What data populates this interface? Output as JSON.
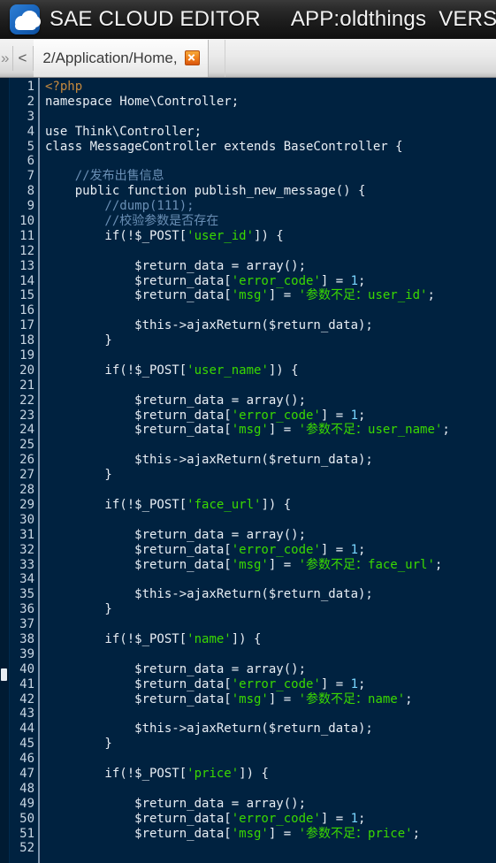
{
  "titlebar": {
    "app_title": "SAE CLOUD EDITOR",
    "app_name": "APP:oldthings",
    "version_label": "VERSIO",
    "logo_icon": "cloud-logo-icon"
  },
  "tabbar": {
    "overflow_chevron": "»",
    "back_arrow": "<",
    "tab_label": "2/Application/Home,",
    "close_icon": "close-icon"
  },
  "editor": {
    "language": "php",
    "first_line": 1,
    "last_line": 52,
    "colors": {
      "background": "#002240",
      "gutter_text": "#c8d6e3",
      "plain": "#e8eef4",
      "comment": "#6a8fb5",
      "string": "#3ad900",
      "number": "#79d6ff",
      "keyword": "#e6e6c8",
      "php_tag": "#c5893d"
    },
    "lines": [
      {
        "n": 1,
        "tokens": [
          {
            "t": "<?php",
            "c": "tag"
          }
        ]
      },
      {
        "n": 2,
        "tokens": [
          {
            "t": "namespace Home\\Controller;",
            "c": "plain"
          }
        ]
      },
      {
        "n": 3,
        "tokens": []
      },
      {
        "n": 4,
        "tokens": [
          {
            "t": "use Think\\Controller;",
            "c": "plain"
          }
        ]
      },
      {
        "n": 5,
        "tokens": [
          {
            "t": "class MessageController extends BaseController {",
            "c": "plain"
          }
        ]
      },
      {
        "n": 6,
        "tokens": []
      },
      {
        "n": 7,
        "tokens": [
          {
            "t": "    //发布出售信息",
            "c": "comment"
          }
        ]
      },
      {
        "n": 8,
        "tokens": [
          {
            "t": "    public function publish_new_message() {",
            "c": "plain"
          }
        ]
      },
      {
        "n": 9,
        "tokens": [
          {
            "t": "        //dump(111);",
            "c": "comment"
          }
        ]
      },
      {
        "n": 10,
        "tokens": [
          {
            "t": "        //校验参数是否存在",
            "c": "comment"
          }
        ]
      },
      {
        "n": 11,
        "tokens": [
          {
            "t": "        if(!$_POST[",
            "c": "plain"
          },
          {
            "t": "'user_id'",
            "c": "string"
          },
          {
            "t": "]) {",
            "c": "plain"
          }
        ]
      },
      {
        "n": 12,
        "tokens": []
      },
      {
        "n": 13,
        "tokens": [
          {
            "t": "            $return_data = array();",
            "c": "plain"
          }
        ]
      },
      {
        "n": 14,
        "tokens": [
          {
            "t": "            $return_data[",
            "c": "plain"
          },
          {
            "t": "'error_code'",
            "c": "string"
          },
          {
            "t": "] = ",
            "c": "plain"
          },
          {
            "t": "1",
            "c": "num"
          },
          {
            "t": ";",
            "c": "plain"
          }
        ]
      },
      {
        "n": 15,
        "tokens": [
          {
            "t": "            $return_data[",
            "c": "plain"
          },
          {
            "t": "'msg'",
            "c": "string"
          },
          {
            "t": "] = ",
            "c": "plain"
          },
          {
            "t": "'参数不足：user_id'",
            "c": "string"
          },
          {
            "t": ";",
            "c": "plain"
          }
        ]
      },
      {
        "n": 16,
        "tokens": []
      },
      {
        "n": 17,
        "tokens": [
          {
            "t": "            $this->ajaxReturn($return_data);",
            "c": "plain"
          }
        ]
      },
      {
        "n": 18,
        "tokens": [
          {
            "t": "        }",
            "c": "plain"
          }
        ]
      },
      {
        "n": 19,
        "tokens": []
      },
      {
        "n": 20,
        "tokens": [
          {
            "t": "        if(!$_POST[",
            "c": "plain"
          },
          {
            "t": "'user_name'",
            "c": "string"
          },
          {
            "t": "]) {",
            "c": "plain"
          }
        ]
      },
      {
        "n": 21,
        "tokens": []
      },
      {
        "n": 22,
        "tokens": [
          {
            "t": "            $return_data = array();",
            "c": "plain"
          }
        ]
      },
      {
        "n": 23,
        "tokens": [
          {
            "t": "            $return_data[",
            "c": "plain"
          },
          {
            "t": "'error_code'",
            "c": "string"
          },
          {
            "t": "] = ",
            "c": "plain"
          },
          {
            "t": "1",
            "c": "num"
          },
          {
            "t": ";",
            "c": "plain"
          }
        ]
      },
      {
        "n": 24,
        "tokens": [
          {
            "t": "            $return_data[",
            "c": "plain"
          },
          {
            "t": "'msg'",
            "c": "string"
          },
          {
            "t": "] = ",
            "c": "plain"
          },
          {
            "t": "'参数不足：user_name'",
            "c": "string"
          },
          {
            "t": ";",
            "c": "plain"
          }
        ]
      },
      {
        "n": 25,
        "tokens": []
      },
      {
        "n": 26,
        "tokens": [
          {
            "t": "            $this->ajaxReturn($return_data);",
            "c": "plain"
          }
        ]
      },
      {
        "n": 27,
        "tokens": [
          {
            "t": "        }",
            "c": "plain"
          }
        ]
      },
      {
        "n": 28,
        "tokens": []
      },
      {
        "n": 29,
        "tokens": [
          {
            "t": "        if(!$_POST[",
            "c": "plain"
          },
          {
            "t": "'face_url'",
            "c": "string"
          },
          {
            "t": "]) {",
            "c": "plain"
          }
        ]
      },
      {
        "n": 30,
        "tokens": []
      },
      {
        "n": 31,
        "tokens": [
          {
            "t": "            $return_data = array();",
            "c": "plain"
          }
        ]
      },
      {
        "n": 32,
        "tokens": [
          {
            "t": "            $return_data[",
            "c": "plain"
          },
          {
            "t": "'error_code'",
            "c": "string"
          },
          {
            "t": "] = ",
            "c": "plain"
          },
          {
            "t": "1",
            "c": "num"
          },
          {
            "t": ";",
            "c": "plain"
          }
        ]
      },
      {
        "n": 33,
        "tokens": [
          {
            "t": "            $return_data[",
            "c": "plain"
          },
          {
            "t": "'msg'",
            "c": "string"
          },
          {
            "t": "] = ",
            "c": "plain"
          },
          {
            "t": "'参数不足：face_url'",
            "c": "string"
          },
          {
            "t": ";",
            "c": "plain"
          }
        ]
      },
      {
        "n": 34,
        "tokens": []
      },
      {
        "n": 35,
        "tokens": [
          {
            "t": "            $this->ajaxReturn($return_data);",
            "c": "plain"
          }
        ]
      },
      {
        "n": 36,
        "tokens": [
          {
            "t": "        }",
            "c": "plain"
          }
        ]
      },
      {
        "n": 37,
        "tokens": []
      },
      {
        "n": 38,
        "tokens": [
          {
            "t": "        if(!$_POST[",
            "c": "plain"
          },
          {
            "t": "'name'",
            "c": "string"
          },
          {
            "t": "]) {",
            "c": "plain"
          }
        ]
      },
      {
        "n": 39,
        "tokens": []
      },
      {
        "n": 40,
        "tokens": [
          {
            "t": "            $return_data = array();",
            "c": "plain"
          }
        ]
      },
      {
        "n": 41,
        "tokens": [
          {
            "t": "            $return_data[",
            "c": "plain"
          },
          {
            "t": "'error_code'",
            "c": "string"
          },
          {
            "t": "] = ",
            "c": "plain"
          },
          {
            "t": "1",
            "c": "num"
          },
          {
            "t": ";",
            "c": "plain"
          }
        ]
      },
      {
        "n": 42,
        "tokens": [
          {
            "t": "            $return_data[",
            "c": "plain"
          },
          {
            "t": "'msg'",
            "c": "string"
          },
          {
            "t": "] = ",
            "c": "plain"
          },
          {
            "t": "'参数不足：name'",
            "c": "string"
          },
          {
            "t": ";",
            "c": "plain"
          }
        ]
      },
      {
        "n": 43,
        "tokens": []
      },
      {
        "n": 44,
        "tokens": [
          {
            "t": "            $this->ajaxReturn($return_data);",
            "c": "plain"
          }
        ]
      },
      {
        "n": 45,
        "tokens": [
          {
            "t": "        }",
            "c": "plain"
          }
        ]
      },
      {
        "n": 46,
        "tokens": []
      },
      {
        "n": 47,
        "tokens": [
          {
            "t": "        if(!$_POST[",
            "c": "plain"
          },
          {
            "t": "'price'",
            "c": "string"
          },
          {
            "t": "]) {",
            "c": "plain"
          }
        ]
      },
      {
        "n": 48,
        "tokens": []
      },
      {
        "n": 49,
        "tokens": [
          {
            "t": "            $return_data = array();",
            "c": "plain"
          }
        ]
      },
      {
        "n": 50,
        "tokens": [
          {
            "t": "            $return_data[",
            "c": "plain"
          },
          {
            "t": "'error_code'",
            "c": "string"
          },
          {
            "t": "] = ",
            "c": "plain"
          },
          {
            "t": "1",
            "c": "num"
          },
          {
            "t": ";",
            "c": "plain"
          }
        ]
      },
      {
        "n": 51,
        "tokens": [
          {
            "t": "            $return_data[",
            "c": "plain"
          },
          {
            "t": "'msg'",
            "c": "string"
          },
          {
            "t": "] = ",
            "c": "plain"
          },
          {
            "t": "'参数不足：price'",
            "c": "string"
          },
          {
            "t": ";",
            "c": "plain"
          }
        ]
      },
      {
        "n": 52,
        "tokens": []
      }
    ]
  }
}
